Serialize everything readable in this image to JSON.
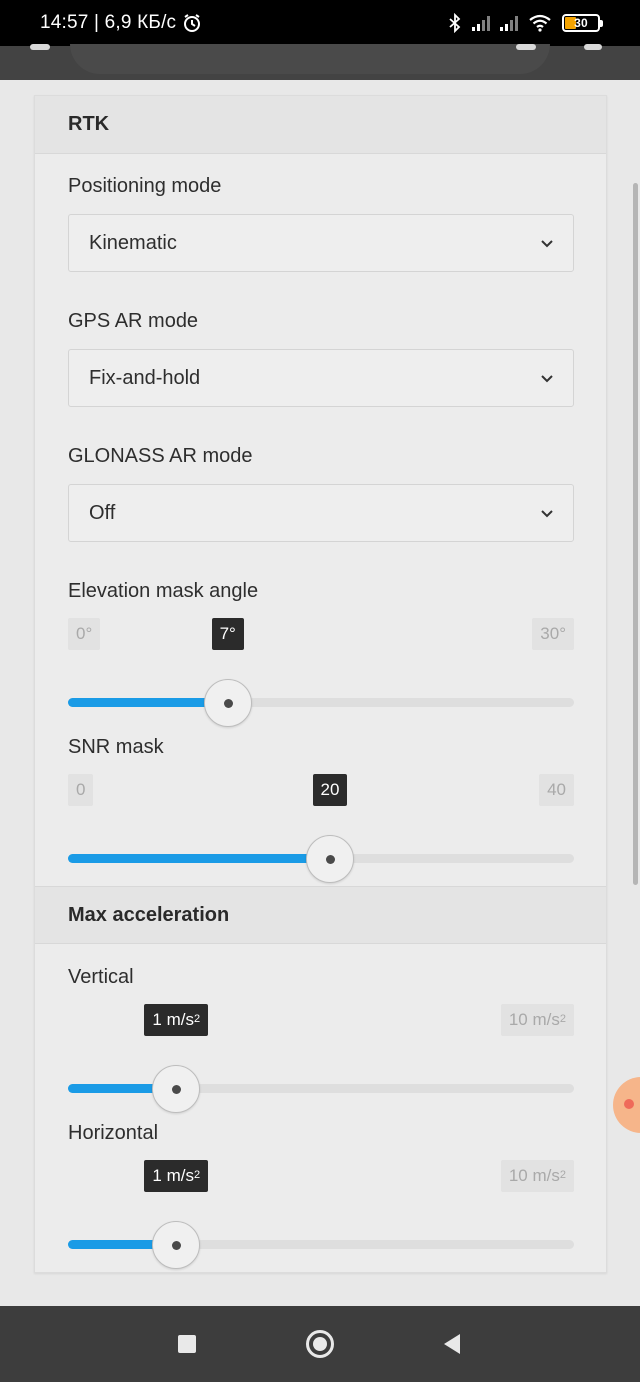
{
  "status_bar": {
    "time_speed": "14:57 | 6,9 КБ/с",
    "alarm_icon": "alarm-clock-icon",
    "battery_level": "30"
  },
  "rtk_section": {
    "title": "RTK",
    "positioning_mode": {
      "label": "Positioning mode",
      "value": "Kinematic"
    },
    "gps_ar_mode": {
      "label": "GPS AR mode",
      "value": "Fix-and-hold"
    },
    "glonass_ar_mode": {
      "label": "GLONASS AR mode",
      "value": "Off"
    },
    "elevation_mask": {
      "label": "Elevation mask angle",
      "min": "0°",
      "max": "30°",
      "current": "7°",
      "value": 7,
      "range": [
        0,
        30
      ]
    },
    "snr_mask": {
      "label": "SNR mask",
      "min": "0",
      "max": "40",
      "current": "20",
      "value": 20,
      "range": [
        0,
        40
      ]
    }
  },
  "max_acceleration_section": {
    "title": "Max acceleration",
    "vertical": {
      "label": "Vertical",
      "current_value": "1 m/s",
      "max_value": "10 m/s",
      "unit_exp": "2",
      "value": 1,
      "range": [
        0,
        10
      ]
    },
    "horizontal": {
      "label": "Horizontal",
      "current_value": "1 m/s",
      "max_value": "10 m/s",
      "unit_exp": "2",
      "value": 1,
      "range": [
        0,
        10
      ]
    }
  },
  "nav_bar": {
    "recents_icon": "square-icon",
    "home_icon": "circle-icon",
    "back_icon": "triangle-back-icon"
  },
  "colors": {
    "accent": "#1a9be6",
    "value_tag": "#2b2b2b",
    "background": "#e8e8e8"
  }
}
